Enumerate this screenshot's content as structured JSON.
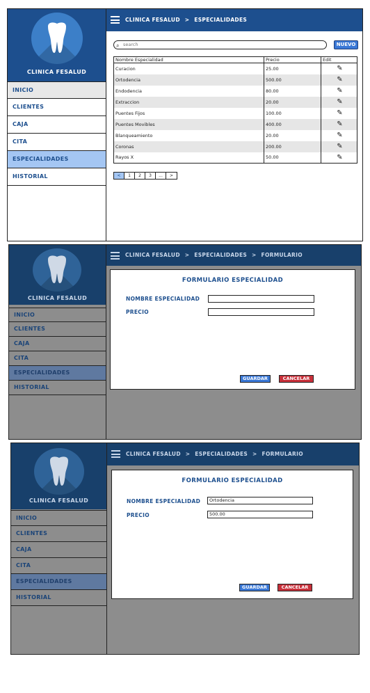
{
  "app": {
    "brand": "CLINICA FESALUD",
    "menu": [
      "INICIO",
      "CLIENTES",
      "CAJA",
      "CITA",
      "ESPECIALIDADES",
      "HISTORIAL"
    ]
  },
  "screen1": {
    "breadcrumb": [
      "CLINICA FESALUD",
      ">",
      "ESPECIALIDADES"
    ],
    "search_placeholder": "search",
    "new_button": "NUEVO",
    "table": {
      "headers": [
        "Nombre Especialidad",
        "Precio",
        "Edit"
      ],
      "rows": [
        [
          "Curacion",
          "25.00"
        ],
        [
          "Ortodencia",
          "500.00"
        ],
        [
          "Endodencia",
          "80.00"
        ],
        [
          "Extraccion",
          "20.00"
        ],
        [
          "Puentes Fijos",
          "100.00"
        ],
        [
          "Puentes Movibles",
          "400.00"
        ],
        [
          "Blanqueamiento",
          "20.00"
        ],
        [
          "Coronas",
          "200.00"
        ],
        [
          "Rayos X",
          "50.00"
        ]
      ]
    },
    "pagination": [
      "<",
      "1",
      "2",
      "3",
      "...",
      ">"
    ]
  },
  "screen2": {
    "breadcrumb": [
      "CLINICA FESALUD",
      ">",
      "ESPECIALIDADES",
      ">",
      "FORMULARIO"
    ],
    "form_title": "FORMULARIO ESPECIALIDAD",
    "label_nombre": "NOMBRE ESPECIALIDAD",
    "label_precio": "PRECIO",
    "value_nombre": "",
    "value_precio": "",
    "save_button": "GUARDAR",
    "cancel_button": "CANCELAR"
  },
  "screen3": {
    "breadcrumb": [
      "CLINICA FESALUD",
      ">",
      "ESPECIALIDADES",
      ">",
      "FORMULARIO"
    ],
    "form_title": "FORMULARIO ESPECIALIDAD",
    "label_nombre": "NOMBRE ESPECIALIDAD",
    "label_precio": "PRECIO",
    "value_nombre": "Ortodencia",
    "value_precio": "500.00",
    "save_button": "GUARDAR",
    "cancel_button": "CANCELAR"
  },
  "colors": {
    "primary": "#1d4f8e",
    "accent_blue": "#3a78d6",
    "active_menu": "#a4c6f3",
    "cancel_red": "#c8303a",
    "dim_gray": "#8d8d8d"
  },
  "icons": [
    "hamburger-menu-icon",
    "tooth-logo-icon",
    "search-icon",
    "pencil-edit-icon"
  ]
}
